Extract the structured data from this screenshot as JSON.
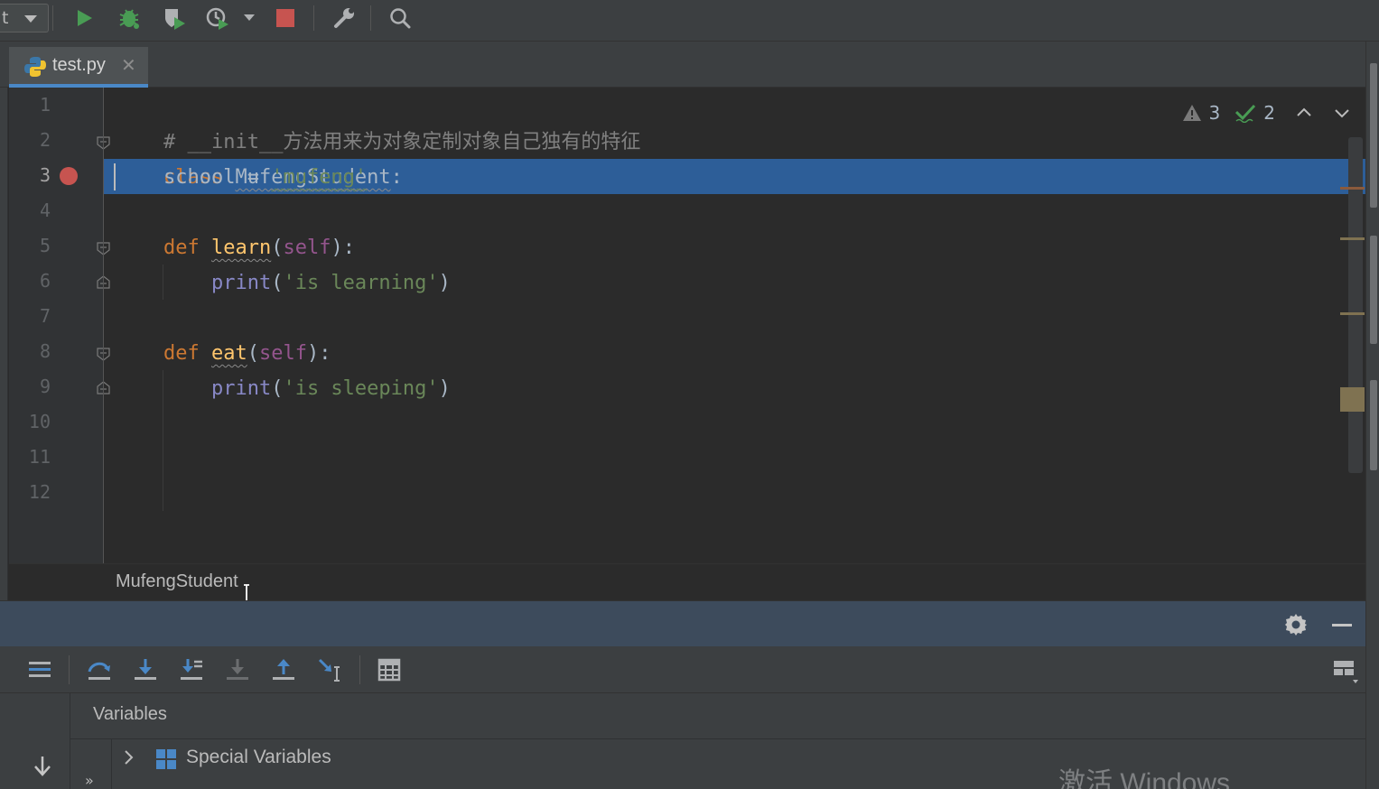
{
  "toolbar": {
    "config_label": "t",
    "buttons": [
      "run-icon",
      "debug-icon",
      "coverage-icon",
      "profile-icon",
      "stop-icon",
      "wrench-icon",
      "search-icon"
    ]
  },
  "tab": {
    "label": "test.py",
    "close": "✕"
  },
  "editor": {
    "line_numbers": [
      "1",
      "2",
      "3",
      "4",
      "5",
      "6",
      "7",
      "8",
      "9",
      "10",
      "11",
      "12"
    ],
    "current_line": 3,
    "code": {
      "l1": "# __init__方法用来为对象定制对象自己独有的特征",
      "l2_kw": "class",
      "l2_name": "MufengStudent",
      "l2_colon": ":",
      "l3_var": "school",
      "l3_eq": " = ",
      "l3_str": "'mufeng'",
      "l5_kw": "def",
      "l5_fn": "learn",
      "l5_open": "(",
      "l5_self": "self",
      "l5_close": "):",
      "l6_fn": "print",
      "l6_open": "(",
      "l6_str": "'is learning'",
      "l6_close": ")",
      "l8_kw": "def",
      "l8_fn": "eat",
      "l8_open": "(",
      "l8_self": "self",
      "l8_close": "):",
      "l9_fn": "print",
      "l9_open": "(",
      "l9_str": "'is sleeping'",
      "l9_close": ")"
    },
    "inspection": {
      "warnings": "3",
      "typos": "2"
    }
  },
  "breadcrumb": {
    "text": "MufengStudent"
  },
  "debug": {
    "variables_title": "Variables",
    "tree": [
      {
        "label": "Special Variables"
      }
    ]
  },
  "watermark": "激活 Windows",
  "colors": {
    "accent": "#4a88c7",
    "selection": "#2d5e98",
    "breakpoint": "#c75450",
    "run_green": "#499c54",
    "stop_red": "#c75450"
  }
}
